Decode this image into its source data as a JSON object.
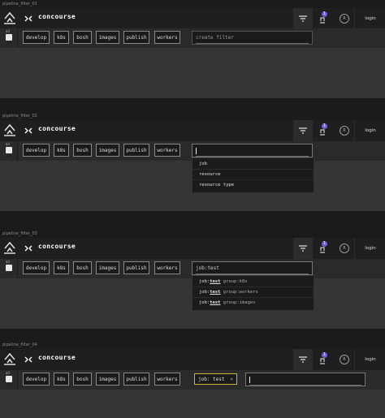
{
  "brand": "concourse",
  "login": "login",
  "avatar_letter": "R",
  "notification_count": "1",
  "all_label": "all",
  "groups": [
    "develop",
    "k8s",
    "bosh",
    "images",
    "publish",
    "workers"
  ],
  "panels": [
    {
      "caption": "pipeline_filter_01",
      "search_placeholder": "create filter",
      "search_value": ""
    },
    {
      "caption": "pipeline_filter_02",
      "search_value": "",
      "suggestions": [
        "job",
        "resource",
        "resource type"
      ]
    },
    {
      "caption": "pipeline_filter_03",
      "search_value": "job:test",
      "suggestions": [
        {
          "scope": "job:",
          "match": "test",
          "rest": " group:k8s"
        },
        {
          "scope": "job:",
          "match": "test",
          "rest": " group:workers"
        },
        {
          "scope": "job:",
          "match": "test",
          "rest": " group:images"
        }
      ]
    },
    {
      "caption": "pipeline_filter_04",
      "chip": "job: test",
      "chip_close": "×",
      "search_value": ""
    }
  ],
  "icons": [
    "concourse-logo-icon",
    "concourse-mark-icon",
    "filter-icon",
    "notification-icon",
    "check-icon",
    "close-icon"
  ]
}
